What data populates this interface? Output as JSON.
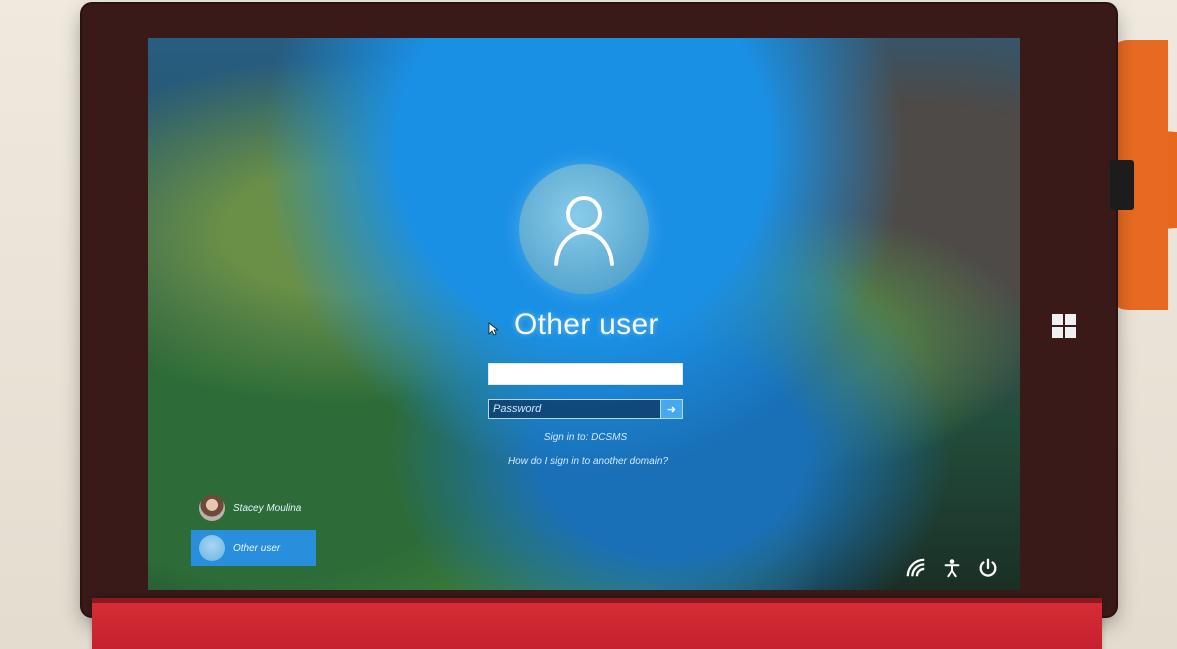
{
  "login": {
    "selected_user": "Other user",
    "username_value": "",
    "password_placeholder": "Password",
    "submit_icon": "arrow-right-icon",
    "sign_in_to": "Sign in to: DCSMS",
    "domain_help_link": "How do I sign in to another domain?"
  },
  "user_list": [
    {
      "name": "Stacey Moulina",
      "avatar": "photo",
      "selected": false
    },
    {
      "name": "Other user",
      "avatar": "generic-user-icon",
      "selected": true
    }
  ],
  "system_icons": [
    "network-icon",
    "ease-of-access-icon",
    "power-icon"
  ],
  "colors": {
    "accent": "#2d8ed8",
    "text": "#f5fbff",
    "keyboard_cover": "#c11f2c"
  }
}
